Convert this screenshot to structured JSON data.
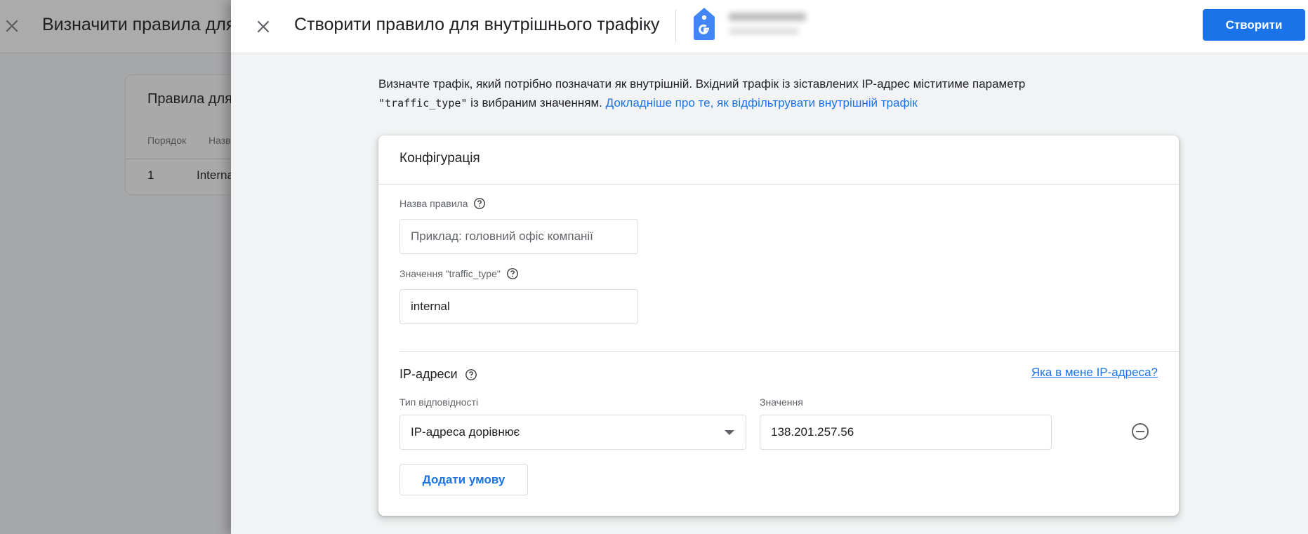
{
  "background": {
    "title": "Визначити правила для",
    "card": {
      "title": "Правила для",
      "columns": [
        "Порядок",
        "Назв"
      ],
      "rows": [
        {
          "order": "1",
          "name": "Interna"
        }
      ]
    }
  },
  "dialog": {
    "title": "Створити правило для внутрішнього трафіку",
    "create_label": "Створити",
    "property_icon": "google-analytics-tag-icon",
    "intro": {
      "text_before": "Визначте трафік, який потрібно позначати як внутрішній. Вхідний трафік із зіставлених IP-адрес міститиме параметр ",
      "code": "\"traffic_type\"",
      "text_after": " із вибраним значенням. ",
      "link": "Докладніше про те, як відфільтрувати внутрішній трафік"
    },
    "config": {
      "title": "Конфігурація",
      "rule_name": {
        "label": "Назва правила",
        "value": "",
        "placeholder": "Приклад: головний офіс компанії"
      },
      "traffic_type": {
        "label": "Значення \"traffic_type\"",
        "value": "internal"
      },
      "ip_section": {
        "title": "IP-адреси",
        "what_is_my_ip_link": "Яка в мене IP-адреса?",
        "match_type_label": "Тип відповідності",
        "match_type_value": "IP-адреса дорівнює",
        "value_label": "Значення",
        "value": "138.201.257.56",
        "add_condition_label": "Додати умову"
      }
    }
  },
  "colors": {
    "accent": "#1a73e8",
    "panel_bg": "#f1f3f4",
    "overlay": "#a6a7a9"
  }
}
